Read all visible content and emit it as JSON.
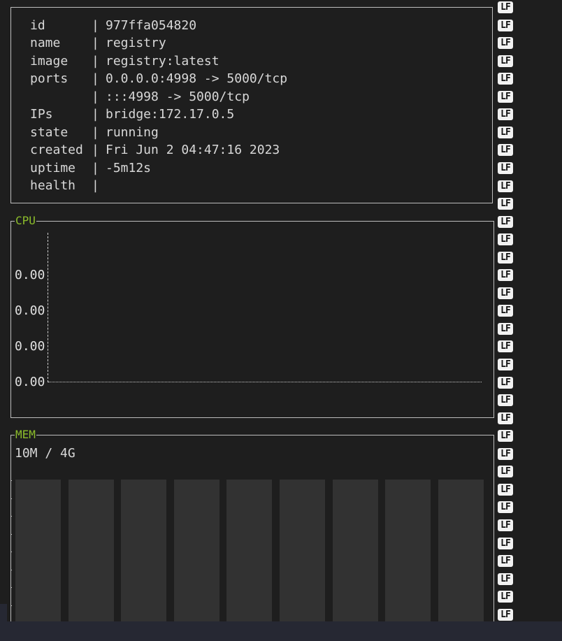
{
  "info": {
    "rows": [
      {
        "key": "id",
        "sep": "|",
        "value": "977ffa054820"
      },
      {
        "key": "name",
        "sep": "|",
        "value": "registry"
      },
      {
        "key": "image",
        "sep": "|",
        "value": "registry:latest"
      },
      {
        "key": "ports",
        "sep": "|",
        "value": "0.0.0.0:4998 -> 5000/tcp"
      },
      {
        "key": "",
        "sep": "|",
        "value": ":::4998 -> 5000/tcp"
      },
      {
        "key": "IPs",
        "sep": "|",
        "value": "bridge:172.17.0.5"
      },
      {
        "key": "state",
        "sep": "|",
        "value": "running"
      },
      {
        "key": "created",
        "sep": "|",
        "value": "Fri Jun 2 04:47:16 2023"
      },
      {
        "key": "uptime",
        "sep": "|",
        "value": "-5m12s"
      },
      {
        "key": "health",
        "sep": "|",
        "value": ""
      }
    ]
  },
  "cpu": {
    "title": "CPU",
    "y_labels": [
      "0.00",
      "0.00",
      "0.00",
      "0.00"
    ]
  },
  "mem": {
    "title": "MEM",
    "usage": "10M / 4G",
    "bar_count": 9
  },
  "lf_marker": "LF",
  "colors": {
    "background": "#1e1e1e",
    "title_accent": "#8cbd2b",
    "border": "#bdbdbd",
    "bar": "#323232"
  }
}
